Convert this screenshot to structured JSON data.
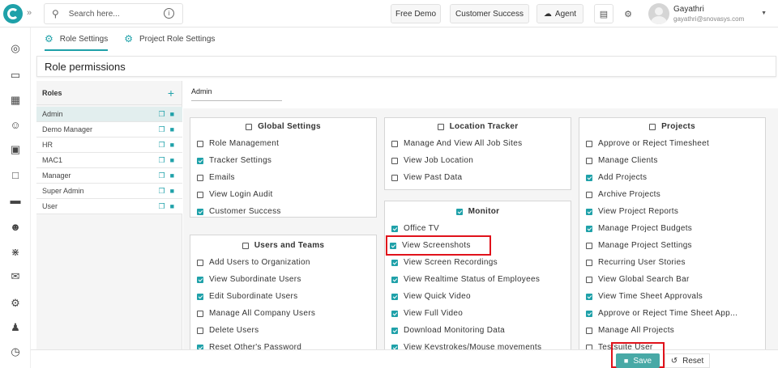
{
  "topbar": {
    "search_placeholder": "Search here...",
    "buttons": [
      "Free Demo",
      "Customer Success",
      "Agent"
    ],
    "user_name": "Gayathri",
    "user_email": "gayathri@snovasys.com"
  },
  "tabs": [
    {
      "label": "Role Settings",
      "active": true
    },
    {
      "label": "Project Role Settings",
      "active": false
    }
  ],
  "panel_title": "Role permissions",
  "roles": {
    "header": "Roles",
    "items": [
      "Admin",
      "Demo Manager",
      "HR",
      "MAC1",
      "Manager",
      "Super Admin",
      "User"
    ]
  },
  "selected_role": "Admin",
  "sections": {
    "global": {
      "title": "Global Settings",
      "items": [
        {
          "label": "Role Management",
          "checked": false
        },
        {
          "label": "Tracker Settings",
          "checked": true
        },
        {
          "label": "Emails",
          "checked": false
        },
        {
          "label": "View Login Audit",
          "checked": false
        },
        {
          "label": "Customer Success",
          "checked": true
        }
      ]
    },
    "users": {
      "title": "Users and Teams",
      "items": [
        {
          "label": "Add Users to Organization",
          "checked": false
        },
        {
          "label": "View Subordinate Users",
          "checked": true
        },
        {
          "label": "Edit Subordinate Users",
          "checked": true
        },
        {
          "label": "Manage All Company Users",
          "checked": false
        },
        {
          "label": "Delete Users",
          "checked": false
        },
        {
          "label": "Reset Other's Password",
          "checked": true
        }
      ]
    },
    "location": {
      "title": "Location Tracker",
      "items": [
        {
          "label": "Manage And View All Job Sites",
          "checked": false
        },
        {
          "label": "View Job Location",
          "checked": false
        },
        {
          "label": "View Past Data",
          "checked": false
        }
      ]
    },
    "monitor": {
      "title": "Monitor",
      "items": [
        {
          "label": "Office TV",
          "checked": true
        },
        {
          "label": "View Screenshots",
          "checked": true
        },
        {
          "label": "View Screen Recordings",
          "checked": true
        },
        {
          "label": "View Realtime Status of Employees",
          "checked": true
        },
        {
          "label": "View Quick Video",
          "checked": true
        },
        {
          "label": "View Full Video",
          "checked": true
        },
        {
          "label": "Download Monitoring Data",
          "checked": true
        },
        {
          "label": "View Keystrokes/Mouse movements",
          "checked": true
        }
      ]
    },
    "projects": {
      "title": "Projects",
      "items": [
        {
          "label": "Approve or Reject Timesheet",
          "checked": false
        },
        {
          "label": "Manage Clients",
          "checked": false
        },
        {
          "label": "Add Projects",
          "checked": true
        },
        {
          "label": "Archive Projects",
          "checked": false
        },
        {
          "label": "View Project Reports",
          "checked": true
        },
        {
          "label": "Manage Project Budgets",
          "checked": true
        },
        {
          "label": "Manage Project Settings",
          "checked": false
        },
        {
          "label": "Recurring User Stories",
          "checked": false
        },
        {
          "label": "View Global Search Bar",
          "checked": false
        },
        {
          "label": "View Time Sheet Approvals",
          "checked": true
        },
        {
          "label": "Approve or Reject Time Sheet App...",
          "checked": true
        },
        {
          "label": "Manage All Projects",
          "checked": false
        },
        {
          "label": "Testsuite User",
          "checked": false
        }
      ]
    }
  },
  "footer": {
    "save_label": "Save",
    "reset_label": "Reset"
  },
  "colors": {
    "accent": "#1fa1a9",
    "highlight": "#e0121b",
    "save": "#48a9a6"
  },
  "icons": {
    "sidebar": [
      "dashboard-icon",
      "calendar-icon",
      "timesheet-icon",
      "user-icon",
      "briefcase-icon",
      "monitor-icon",
      "card-icon",
      "team-icon",
      "org-icon",
      "mail-icon",
      "settings-icon",
      "profile-icon",
      "alarm-icon"
    ]
  }
}
